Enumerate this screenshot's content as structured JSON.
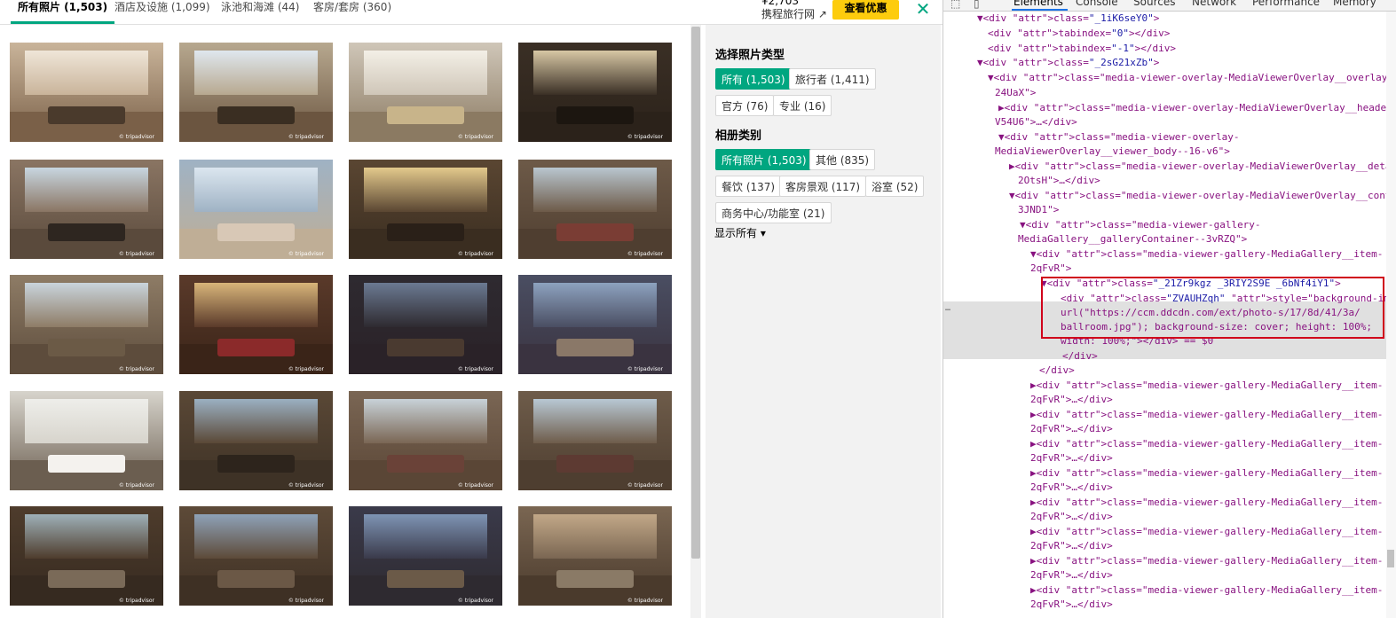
{
  "tabs": [
    {
      "label": "所有照片 (1,503)",
      "active": true
    },
    {
      "label": "酒店及设施 (1,099)",
      "active": false
    },
    {
      "label": "泳池和海滩 (44)",
      "active": false
    },
    {
      "label": "客房/套房 (360)",
      "active": false
    }
  ],
  "header": {
    "price": "¥2,703",
    "site_link": "携程旅行网 ↗",
    "deal_button": "查看优惠",
    "close_glyph": "✕"
  },
  "photo_watermark": "© tripadvisor",
  "photos_count_shown": 20,
  "filters": {
    "photo_type_heading": "选择照片类型",
    "photo_type_chips": [
      {
        "label": "所有 (1,503)",
        "selected": true
      },
      {
        "label": "旅行者 (1,411)",
        "selected": false
      },
      {
        "label": "官方 (76)",
        "selected": false
      },
      {
        "label": "专业 (16)",
        "selected": false
      }
    ],
    "album_heading": "相册类别",
    "album_chips": [
      {
        "label": "所有照片 (1,503)",
        "selected": true
      },
      {
        "label": "其他 (835)",
        "selected": false
      },
      {
        "label": "餐饮 (137)",
        "selected": false
      },
      {
        "label": "客房景观 (117)",
        "selected": false
      },
      {
        "label": "浴室 (52)",
        "selected": false
      },
      {
        "label": "商务中心/功能室 (21)",
        "selected": false
      }
    ],
    "show_all": "显示所有 ▾"
  },
  "devtools": {
    "tabs": [
      "Elements",
      "Console",
      "Sources",
      "Network",
      "Performance",
      "Memory"
    ],
    "active_tab": "Elements",
    "lines": [
      "▼<div class=\"_1iK6seY0\">",
      "<div tabindex=\"0\"></div>",
      "<div tabindex=\"-1\"></div>",
      "▼<div class=\"_2sG21xZb\">",
      "▼<div class=\"media-viewer-overlay-MediaViewerOverlay__overlay-",
      "24UaX\">",
      "▶<div class=\"media-viewer-overlay-MediaViewerOverlay__header_bg--",
      "V54U6\">…</div>",
      "▼<div class=\"media-viewer-overlay-",
      "MediaViewerOverlay__viewer_body--16-v6\">",
      "▶<div class=\"media-viewer-overlay-MediaViewerOverlay__details-",
      "2OtsH\">…</div>",
      "▼<div class=\"media-viewer-overlay-MediaViewerOverlay__content-",
      "3JND1\">",
      "▼<div class=\"media-viewer-gallery-",
      "MediaGallery__galleryContainer--3vRZQ\">",
      "▼<div class=\"media-viewer-gallery-MediaGallery__item-",
      "2qFvR\">",
      "▼<div class=\"_21Zr9kgz _3RIY2S9E _6bNf4iY1\">",
      "<div class=\"ZVAUHZqh\" style=\"background-image:",
      "url(\"https://ccm.ddcdn.com/ext/photo-s/17/8d/41/3a/",
      "ballroom.jpg\"); background-size: cover; height: 100%;",
      "width: 100%;\"></div> == $0",
      "</div>",
      "</div>",
      "▶<div class=\"media-viewer-gallery-MediaGallery__item-",
      "2qFvR\">…</div>",
      "▶<div class=\"media-viewer-gallery-MediaGallery__item-",
      "2qFvR\">…</div>",
      "▶<div class=\"media-viewer-gallery-MediaGallery__item-",
      "2qFvR\">…</div>",
      "▶<div class=\"media-viewer-gallery-MediaGallery__item-",
      "2qFvR\">…</div>",
      "▶<div class=\"media-viewer-gallery-MediaGallery__item-",
      "2qFvR\">…</div>",
      "▶<div class=\"media-viewer-gallery-MediaGallery__item-",
      "2qFvR\">…</div>",
      "▶<div class=\"media-viewer-gallery-MediaGallery__item-",
      "2qFvR\">…</div>",
      "▶<div class=\"media-viewer-gallery-MediaGallery__item-",
      "2qFvR\">…</div>"
    ],
    "ellipsis": "…"
  },
  "colors": {
    "accent": "#00a680",
    "deal": "#fdcc0d",
    "highlight": "#d0021b"
  }
}
